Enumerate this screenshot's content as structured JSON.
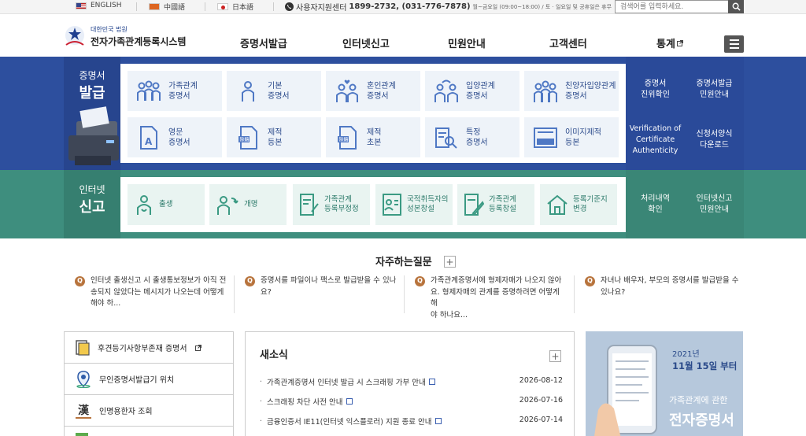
{
  "topbar": {
    "langs": [
      {
        "label": "ENGLISH",
        "icon": "us-flag-icon"
      },
      {
        "label": "中國語",
        "icon": "china-flag-icon"
      },
      {
        "label": "日本語",
        "icon": "japan-flag-icon"
      }
    ],
    "call_center_label": "사용자지원센터",
    "call_center_numbers": "1899-2732, (031-776-7878)",
    "call_center_hours": "월~금요일 (09:00~18:00) / 토 · 일요일 및 공휴일은 휴무",
    "search_placeholder": "검색어를 입력하세요."
  },
  "header": {
    "logo_court": "대한민국 법원",
    "logo_system": "전자가족관계등록시스템",
    "nav": [
      {
        "label": "증명서발급"
      },
      {
        "label": "인터넷신고"
      },
      {
        "label": "민원안내"
      },
      {
        "label": "고객센터"
      },
      {
        "label": "통계"
      }
    ]
  },
  "certificates": {
    "title_small": "증명서",
    "title_big": "발급",
    "tiles": [
      [
        "가족관계",
        "증명서"
      ],
      [
        "기본",
        "증명서"
      ],
      [
        "혼인관계",
        "증명서"
      ],
      [
        "입양관계",
        "증명서"
      ],
      [
        "친양자입양관계",
        "증명서"
      ],
      [
        "영문",
        "증명서"
      ],
      [
        "제적",
        "등본"
      ],
      [
        "제적",
        "초본"
      ],
      [
        "특정",
        "증명서"
      ],
      [
        "이미지제적",
        "등본"
      ]
    ],
    "side_links": [
      [
        "증명서",
        "진위확인"
      ],
      [
        "증명서발급",
        "민원안내"
      ],
      [
        "Verification of",
        "Certificate",
        "Authenticity"
      ],
      [
        "신청서양식",
        "다운로드"
      ]
    ],
    "icon_badge": "이미지"
  },
  "reports": {
    "title_small": "인터넷",
    "title_big": "신고",
    "tiles": [
      [
        "출생"
      ],
      [
        "개명"
      ],
      [
        "가족관계",
        "등록부정정"
      ],
      [
        "국적취득자의",
        "성본창설"
      ],
      [
        "가족관계",
        "등록창설"
      ],
      [
        "등록기준지",
        "변경"
      ]
    ],
    "side_links": [
      [
        "처리내역",
        "확인"
      ],
      [
        "인터넷신고",
        "민원안내"
      ]
    ]
  },
  "faq": {
    "title": "자주하는질문",
    "more": "+",
    "items": [
      {
        "q": "Q",
        "lines": [
          "인터넷 출생신고 시 출생통보정보가 아직 전",
          "송되지 않았다는 메시지가 나오는데 어떻게",
          "해야 하..."
        ]
      },
      {
        "q": "Q",
        "lines": [
          "증명서를 파일이나 팩스로 발급받을 수 있나",
          "요?"
        ]
      },
      {
        "q": "Q",
        "lines": [
          "가족관계증명서에 형제자매가 나오지 않아",
          "요. 형제자매의 관계를 증명하려면 어떻게 해",
          "야 하나요..."
        ]
      },
      {
        "q": "Q",
        "lines": [
          "자녀나 배우자, 부모의 증명서를 발급받을 수",
          "있나요?"
        ]
      }
    ]
  },
  "quick_links": [
    {
      "label": "후견등기사항부존재 증명서"
    },
    {
      "label": "무인증명서발급기 위치"
    },
    {
      "label": "인명용한자 조회"
    }
  ],
  "quick_icon_char": "漢",
  "news": {
    "title": "새소식",
    "more": "+",
    "items": [
      {
        "title": "가족관계증명서 인터넷 발급 시 스크래핑 가부 안내",
        "date": "2026-08-12"
      },
      {
        "title": "스크래핑 차단 사전 안내",
        "date": "2026-07-16"
      },
      {
        "title": "금융인증서 IE11(인터넷 익스플로러) 지원 종료 안내",
        "date": "2026-07-14"
      }
    ]
  },
  "banner": {
    "year": "2021년",
    "date": "11월 15일 부터",
    "line1": "가족관계에 관한",
    "line2": "전자증명서"
  }
}
